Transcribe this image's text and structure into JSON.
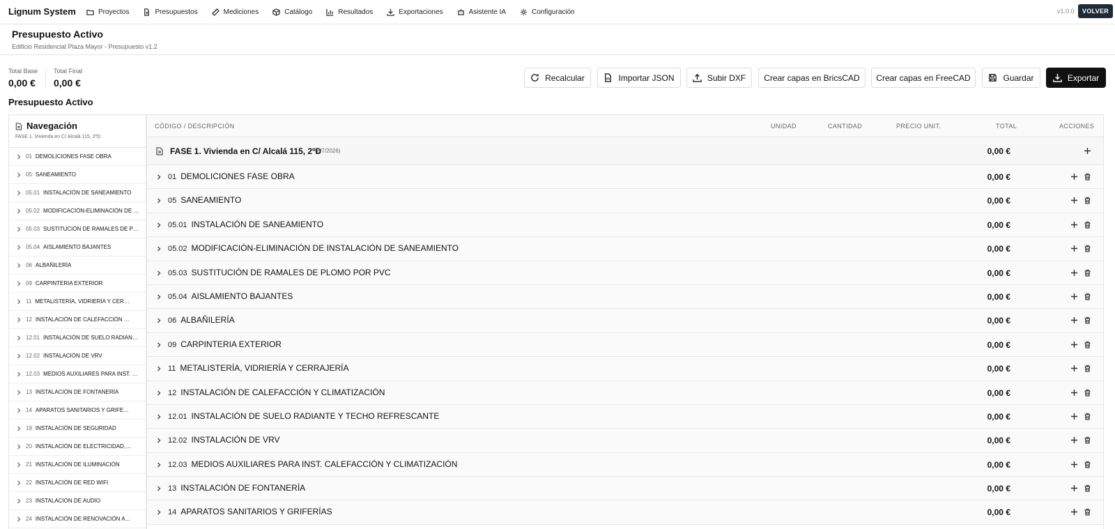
{
  "app": {
    "brand": "Lignum System",
    "version": "v1.0.0",
    "back_label": "VOLVER"
  },
  "nav": [
    {
      "label": "Proyectos",
      "icon": "folder-icon"
    },
    {
      "label": "Presupuestos",
      "icon": "document-icon"
    },
    {
      "label": "Mediciones",
      "icon": "ruler-icon"
    },
    {
      "label": "Catálogo",
      "icon": "box-icon"
    },
    {
      "label": "Resultados",
      "icon": "bar-chart-icon"
    },
    {
      "label": "Exportaciones",
      "icon": "download-icon"
    },
    {
      "label": "Asistente IA",
      "icon": "robot-icon"
    },
    {
      "label": "Configuración",
      "icon": "gear-icon"
    }
  ],
  "header": {
    "title": "Presupuesto Activo",
    "subtitle": "Edificio Residencial Plaza Mayor - Presupuesto v1.2"
  },
  "totals": {
    "base_label": "Total Base",
    "base_value": "0,00 €",
    "final_label": "Total Final",
    "final_value": "0,00 €"
  },
  "actions": {
    "recalcular": "Recalcular",
    "importar_json": "Importar JSON",
    "subir_dxf": "Subir DXF",
    "bricscad": "Crear capas en BricsCAD",
    "freecad": "Crear capas en FreeCAD",
    "guardar": "Guardar",
    "exportar": "Exportar"
  },
  "section_title": "Presupuesto Activo",
  "sidebar": {
    "title": "Navegación",
    "subtitle": "FASE 1. Vivienda en C/ Alcalá 115, 2ºD",
    "items": [
      {
        "code": "01",
        "name": "DEMOLICIONES FASE OBRA"
      },
      {
        "code": "05",
        "name": "SANEAMIENTO"
      },
      {
        "code": "05.01",
        "name": "INSTALACIÓN DE SANEAMIENTO"
      },
      {
        "code": "05.02",
        "name": "MODIFICACIÓN-ELIMINACIÓN DE INSTALACIÓN DE SANEAMIENTO"
      },
      {
        "code": "05.03",
        "name": "SUSTITUCIÓN DE RAMALES DE PLOMO POR PVC"
      },
      {
        "code": "05.04",
        "name": "AISLAMIENTO BAJANTES"
      },
      {
        "code": "06",
        "name": "ALBAÑILERÍA"
      },
      {
        "code": "09",
        "name": "CARPINTERIA EXTERIOR"
      },
      {
        "code": "11",
        "name": "METALISTERÍA, VIDRIERÍA Y CERRAJERÍA"
      },
      {
        "code": "12",
        "name": "INSTALACIÓN DE CALEFACCIÓN Y CLIMATIZACIÓN"
      },
      {
        "code": "12.01",
        "name": "INSTALACIÓN DE SUELO RADIANTE Y TECHO REFRESCANTE"
      },
      {
        "code": "12.02",
        "name": "INSTALACIÓN DE VRV"
      },
      {
        "code": "12.03",
        "name": "MEDIOS AUXILIARES PARA INST. CALEFACCIÓN Y CLIMATIZACIÓN"
      },
      {
        "code": "13",
        "name": "INSTALACIÓN DE FONTANERÍA"
      },
      {
        "code": "14",
        "name": "APARATOS SANITARIOS Y GRIFERÍAS"
      },
      {
        "code": "19",
        "name": "INSTALACIÓN DE SEGURIDAD"
      },
      {
        "code": "20",
        "name": "INSTALACIÓN DE ELECTRICIDAD, DATOS Y TV"
      },
      {
        "code": "21",
        "name": "INSTALACIÓN DE ILUMINACIÓN"
      },
      {
        "code": "22",
        "name": "INSTALACIÓN DE RED WIFI"
      },
      {
        "code": "23",
        "name": "INSTALACIÓN DE AUDIO"
      },
      {
        "code": "24",
        "name": "INSTALACIÓN DE RENOVACIÓN AIRE"
      }
    ]
  },
  "table": {
    "columns": {
      "codigo": "CÓDIGO / DESCRIPCIÓN",
      "unidad": "UNIDAD",
      "cantidad": "CANTIDAD",
      "precio": "PRECIO UNIT.",
      "total": "TOTAL",
      "acciones": "ACCIONES"
    },
    "phase": {
      "title": "FASE 1. Vivienda en C/ Alcalá 115, 2ºD",
      "date": "(8/7/2026)",
      "total": "0,00 €"
    },
    "rows": [
      {
        "code": "01",
        "name": "DEMOLICIONES FASE OBRA",
        "total": "0,00 €"
      },
      {
        "code": "05",
        "name": "SANEAMIENTO",
        "total": "0,00 €"
      },
      {
        "code": "05.01",
        "name": "INSTALACIÓN DE SANEAMIENTO",
        "total": "0,00 €"
      },
      {
        "code": "05.02",
        "name": "MODIFICACIÓN-ELIMINACIÓN DE INSTALACIÓN DE SANEAMIENTO",
        "total": "0,00 €"
      },
      {
        "code": "05.03",
        "name": "SUSTITUCIÓN DE RAMALES DE PLOMO POR PVC",
        "total": "0,00 €"
      },
      {
        "code": "05.04",
        "name": "AISLAMIENTO BAJANTES",
        "total": "0,00 €"
      },
      {
        "code": "06",
        "name": "ALBAÑILERÍA",
        "total": "0,00 €"
      },
      {
        "code": "09",
        "name": "CARPINTERIA EXTERIOR",
        "total": "0,00 €"
      },
      {
        "code": "11",
        "name": "METALISTERÍA, VIDRIERÍA Y CERRAJERÍA",
        "total": "0,00 €"
      },
      {
        "code": "12",
        "name": "INSTALACIÓN DE CALEFACCIÓN Y CLIMATIZACIÓN",
        "total": "0,00 €"
      },
      {
        "code": "12.01",
        "name": "INSTALACIÓN DE SUELO RADIANTE Y TECHO REFRESCANTE",
        "total": "0,00 €"
      },
      {
        "code": "12.02",
        "name": "INSTALACIÓN DE VRV",
        "total": "0,00 €"
      },
      {
        "code": "12.03",
        "name": "MEDIOS AUXILIARES PARA INST. CALEFACCIÓN Y CLIMATIZACIÓN",
        "total": "0,00 €"
      },
      {
        "code": "13",
        "name": "INSTALACIÓN DE FONTANERÍA",
        "total": "0,00 €"
      },
      {
        "code": "14",
        "name": "APARATOS SANITARIOS Y GRIFERÍAS",
        "total": "0,00 €"
      }
    ]
  }
}
